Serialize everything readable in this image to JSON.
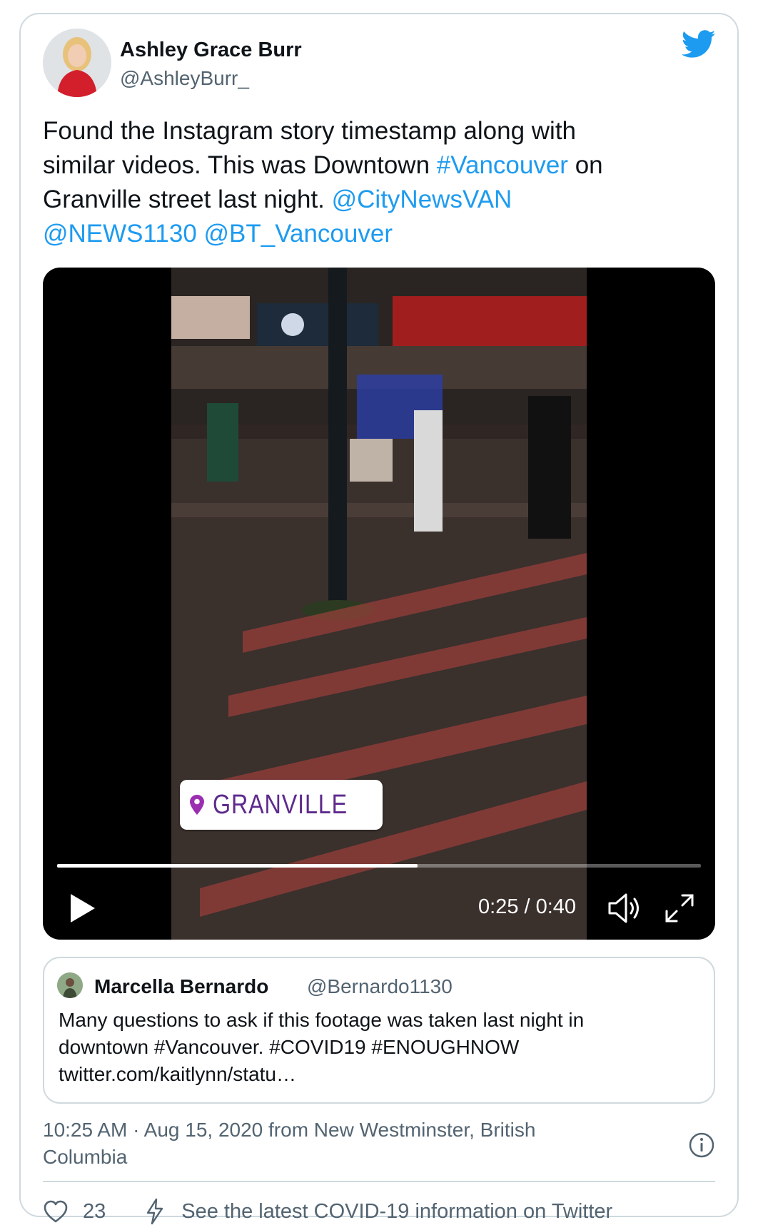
{
  "author": {
    "name": "Ashley Grace Burr",
    "handle": "@AshleyBurr_"
  },
  "tweet": {
    "line1": "Found the Instagram story timestamp along with",
    "line2_a": "similar videos. This was Downtown ",
    "hashtag_vancouver": "#Vancouver",
    "line2_b": " on",
    "line3_a": "Granville street last night. ",
    "mention_citynews": "@CityNewsVAN",
    "mention_news1130": "@NEWS1130",
    "mention_bt": "@BT_Vancouver"
  },
  "video": {
    "location_sticker": "GRANVILLE",
    "time": "0:25 / 0:40",
    "progress_fraction": 0.56
  },
  "quoted_tweet": {
    "name": "Marcella Bernardo",
    "handle": "@Bernardo1130",
    "text_line1": "Many questions to ask if this footage was taken last night in",
    "text_line2": "downtown #Vancouver. #COVID19 #ENOUGHNOW",
    "text_line3": "twitter.com/kaitlynn/statu…"
  },
  "meta": {
    "line1": "10:25 AM · Aug 15, 2020 from New Westminster, British",
    "line2": "Columbia"
  },
  "footer": {
    "like_count": "23",
    "covid_info": "See the latest COVID-19 information on Twitter"
  },
  "colors": {
    "link": "#1d9bf0",
    "secondary_text": "#536471",
    "border": "#cfd9de",
    "twitter_blue": "#1d9bf0"
  },
  "icons": [
    "twitter-bird-icon",
    "play-icon",
    "volume-icon",
    "fullscreen-icon",
    "info-icon",
    "heart-icon",
    "lightning-icon",
    "location-pin-icon"
  ]
}
